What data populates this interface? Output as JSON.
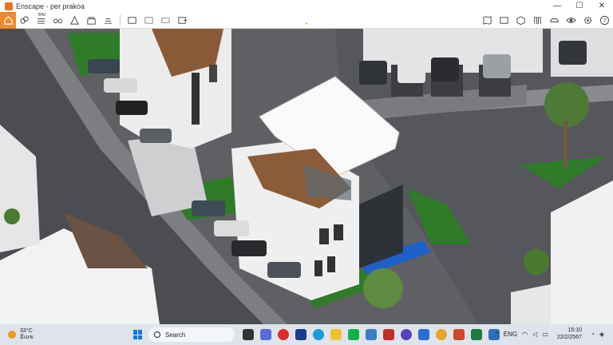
{
  "window": {
    "title": "Enscape - per prakoa",
    "minimize": "—",
    "maximize": "☐",
    "close": "✕"
  },
  "toolbar": {
    "bim_label": "BIM",
    "caret": "⌃"
  },
  "taskbar": {
    "weather_temp": "33°C",
    "weather_desc": "มีเมฆ",
    "search_placeholder": "Search",
    "language": "ENG",
    "time": "15:10",
    "date": "22/2/2567"
  },
  "colors": {
    "accent": "#f08a2a",
    "taskbar": "#dfe4ec"
  }
}
